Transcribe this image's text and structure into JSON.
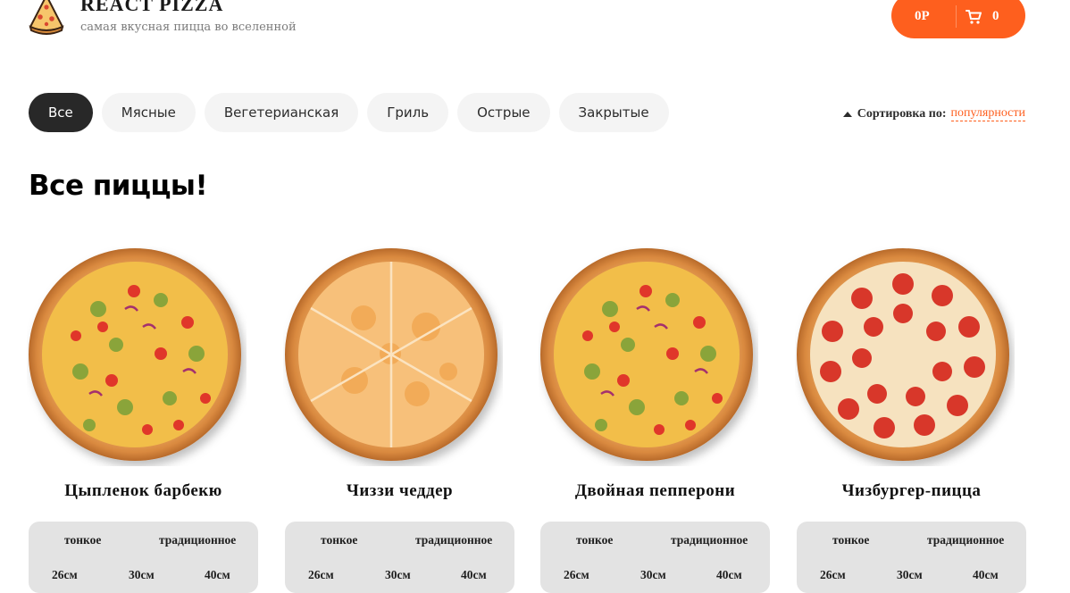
{
  "header": {
    "title": "REACT PIZZA",
    "subtitle": "самая вкусная пицца во вселенной",
    "cart": {
      "price": "0Р",
      "count": "0"
    }
  },
  "categories": [
    "Все",
    "Мясные",
    "Вегетерианская",
    "Гриль",
    "Острые",
    "Закрытые"
  ],
  "active_category": "Все",
  "sort": {
    "label": "Сортировка по:",
    "value": "популярности"
  },
  "page_title": "Все пиццы!",
  "pizzas": [
    {
      "name": "Цыпленок барбекю",
      "image": "bbq-chicken-pizza"
    },
    {
      "name": "Чиззи чеддер",
      "image": "cheese-pizza"
    },
    {
      "name": "Двойная пепперони",
      "image": "bbq-chicken-pizza"
    },
    {
      "name": "Чизбургер-пицца",
      "image": "pepperoni-pizza"
    }
  ],
  "dough_types": [
    "тонкое",
    "традиционное"
  ],
  "sizes": [
    "26см",
    "30см",
    "40см"
  ],
  "colors": {
    "accent": "#fe5f1e",
    "active_category": "#282828",
    "category_bg": "#f4f4f4",
    "selector_bg": "#e3e3e3"
  }
}
